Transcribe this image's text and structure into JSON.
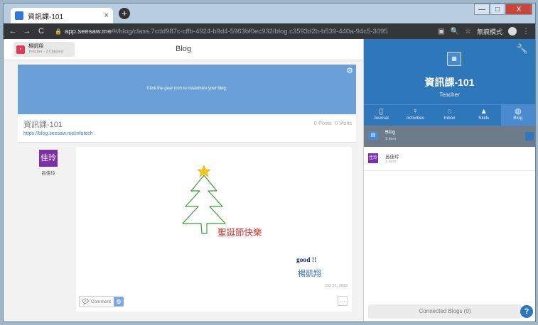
{
  "browser": {
    "tab_title": "資訊課-101",
    "tab_close": "×",
    "new_tab": "+",
    "win_min": "—",
    "win_max": "□",
    "win_close": "X",
    "nav_back": "←",
    "nav_forward": "→",
    "nav_reload": "C",
    "url_host": "app.seesaw.me",
    "url_path": "/#/blog/class.7cdd987c-cffb-4924-b9d4-5963bf0ec932/blog.c3593d2b-b539-440a-94c5-3095b6bcdb5c",
    "incognito_label": "無痕模式"
  },
  "header": {
    "user_name": "楊凱翔",
    "user_role": "Teacher - 2 Classes",
    "page_title": "Blog"
  },
  "banner": {
    "text": "Click the gear icon to customize your blog."
  },
  "blog": {
    "class_name": "資訊課-101",
    "url": "https://blog.seesaw.me/infotech",
    "posts": "0 Posts",
    "visits": "0 Visits"
  },
  "student": {
    "avatar_text": "佳玲",
    "name": "呂佳玲"
  },
  "post": {
    "drawing_text": "聖誕節快樂",
    "comment_text": "good !!",
    "signature": "楊凱翔",
    "date": "Oct 21, 2019",
    "comment_button": "Comment",
    "more": "..."
  },
  "right_panel": {
    "class_name": "資訊課-101",
    "role": "Teacher",
    "tabs": [
      {
        "label": "Journal",
        "icon": "book-icon"
      },
      {
        "label": "Activities",
        "icon": "bulb-icon"
      },
      {
        "label": "Inbox",
        "icon": "chat-icon"
      },
      {
        "label": "Skills",
        "icon": "graduation-cap-icon"
      },
      {
        "label": "Blog",
        "icon": "globe-icon"
      }
    ],
    "selected": {
      "label": "Blog",
      "count": "1 item"
    },
    "items": [
      {
        "avatar": "佳玲",
        "name": "呂佳玲",
        "count": "1 item"
      }
    ],
    "connected_blogs": "Connected Blogs (0)",
    "help": "?"
  }
}
